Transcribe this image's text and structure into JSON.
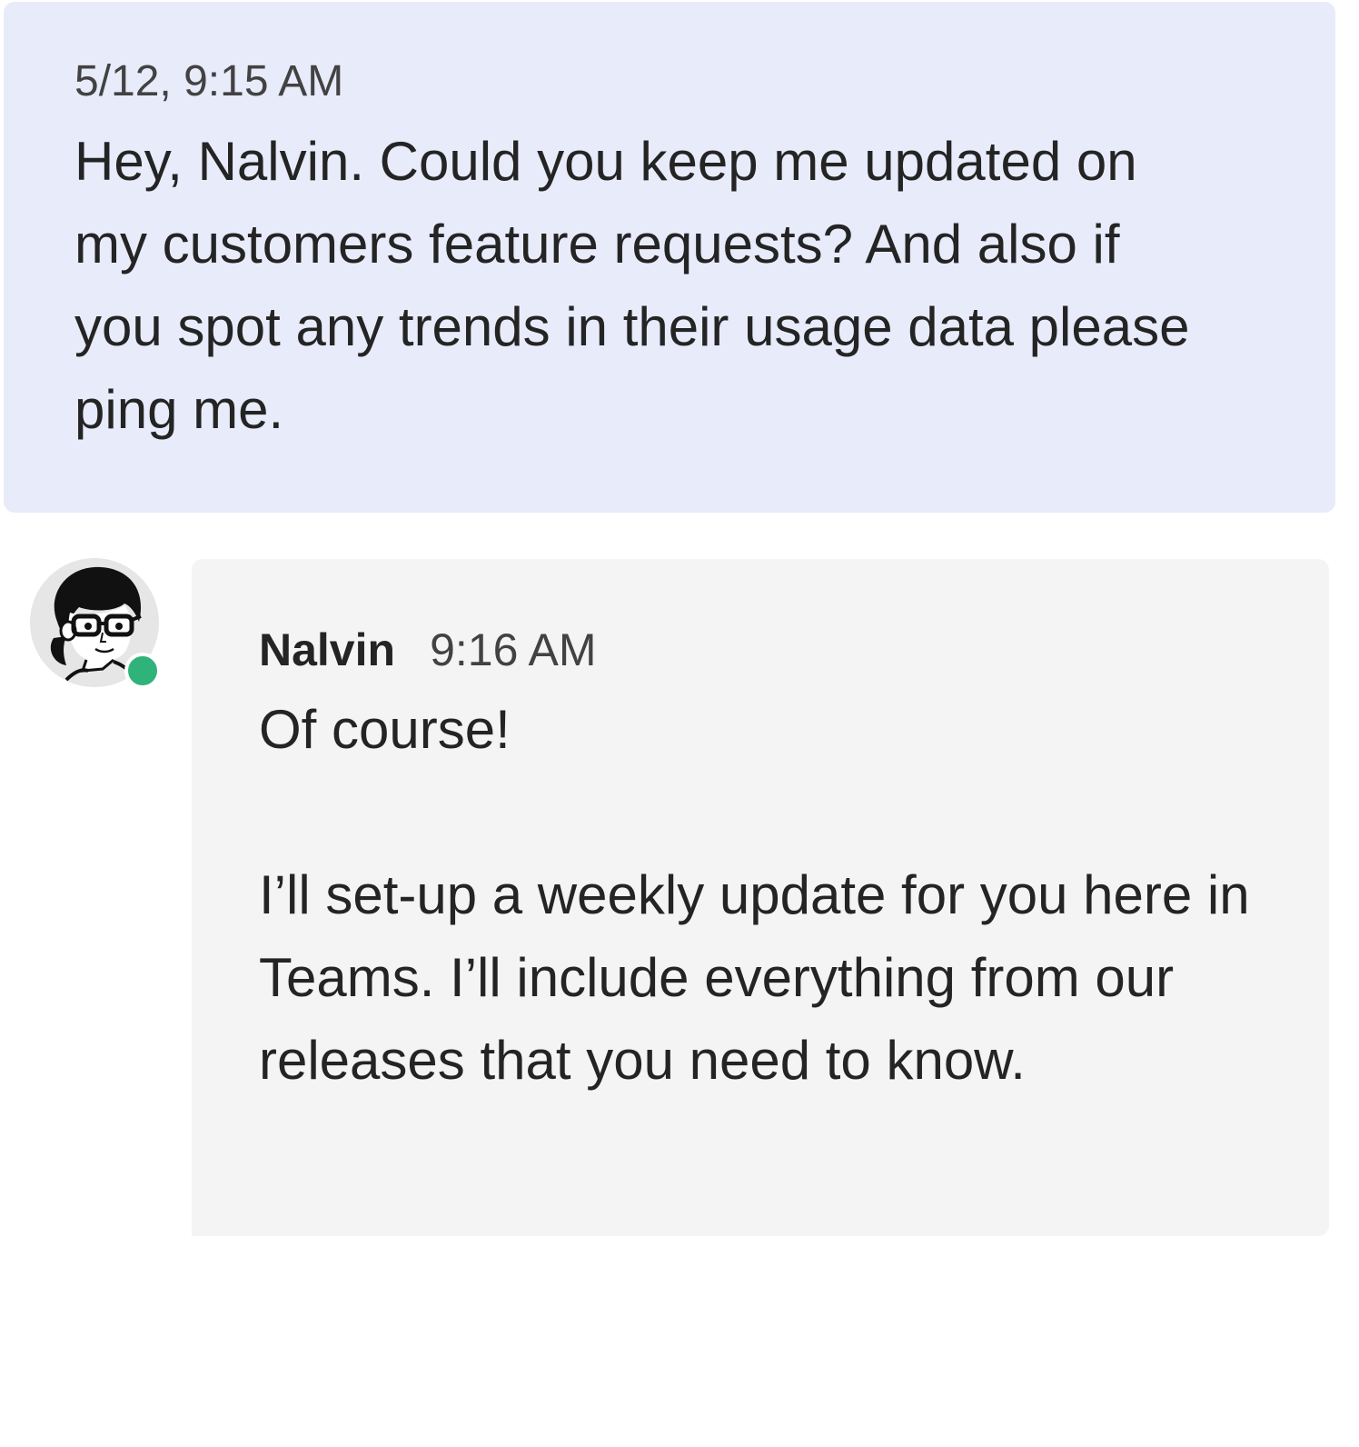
{
  "sent_message": {
    "timestamp": "5/12, 9:15 AM",
    "text": "Hey, Nalvin. Could you keep me updated on my customers feature requests? And also if you spot any trends in their usage data please ping me."
  },
  "received_message": {
    "sender": "Nalvin",
    "timestamp": "9:16 AM",
    "paragraphs": [
      "Of course!",
      "I’ll set-up a weekly update for you here in Teams. I’ll include everything from our releases that you need to know."
    ],
    "presence": "available",
    "avatar_icon": "person-avatar-icon"
  },
  "colors": {
    "sent_bubble": "#e8ebfa",
    "received_bubble": "#f4f4f4",
    "presence_available": "#2fb37a"
  }
}
